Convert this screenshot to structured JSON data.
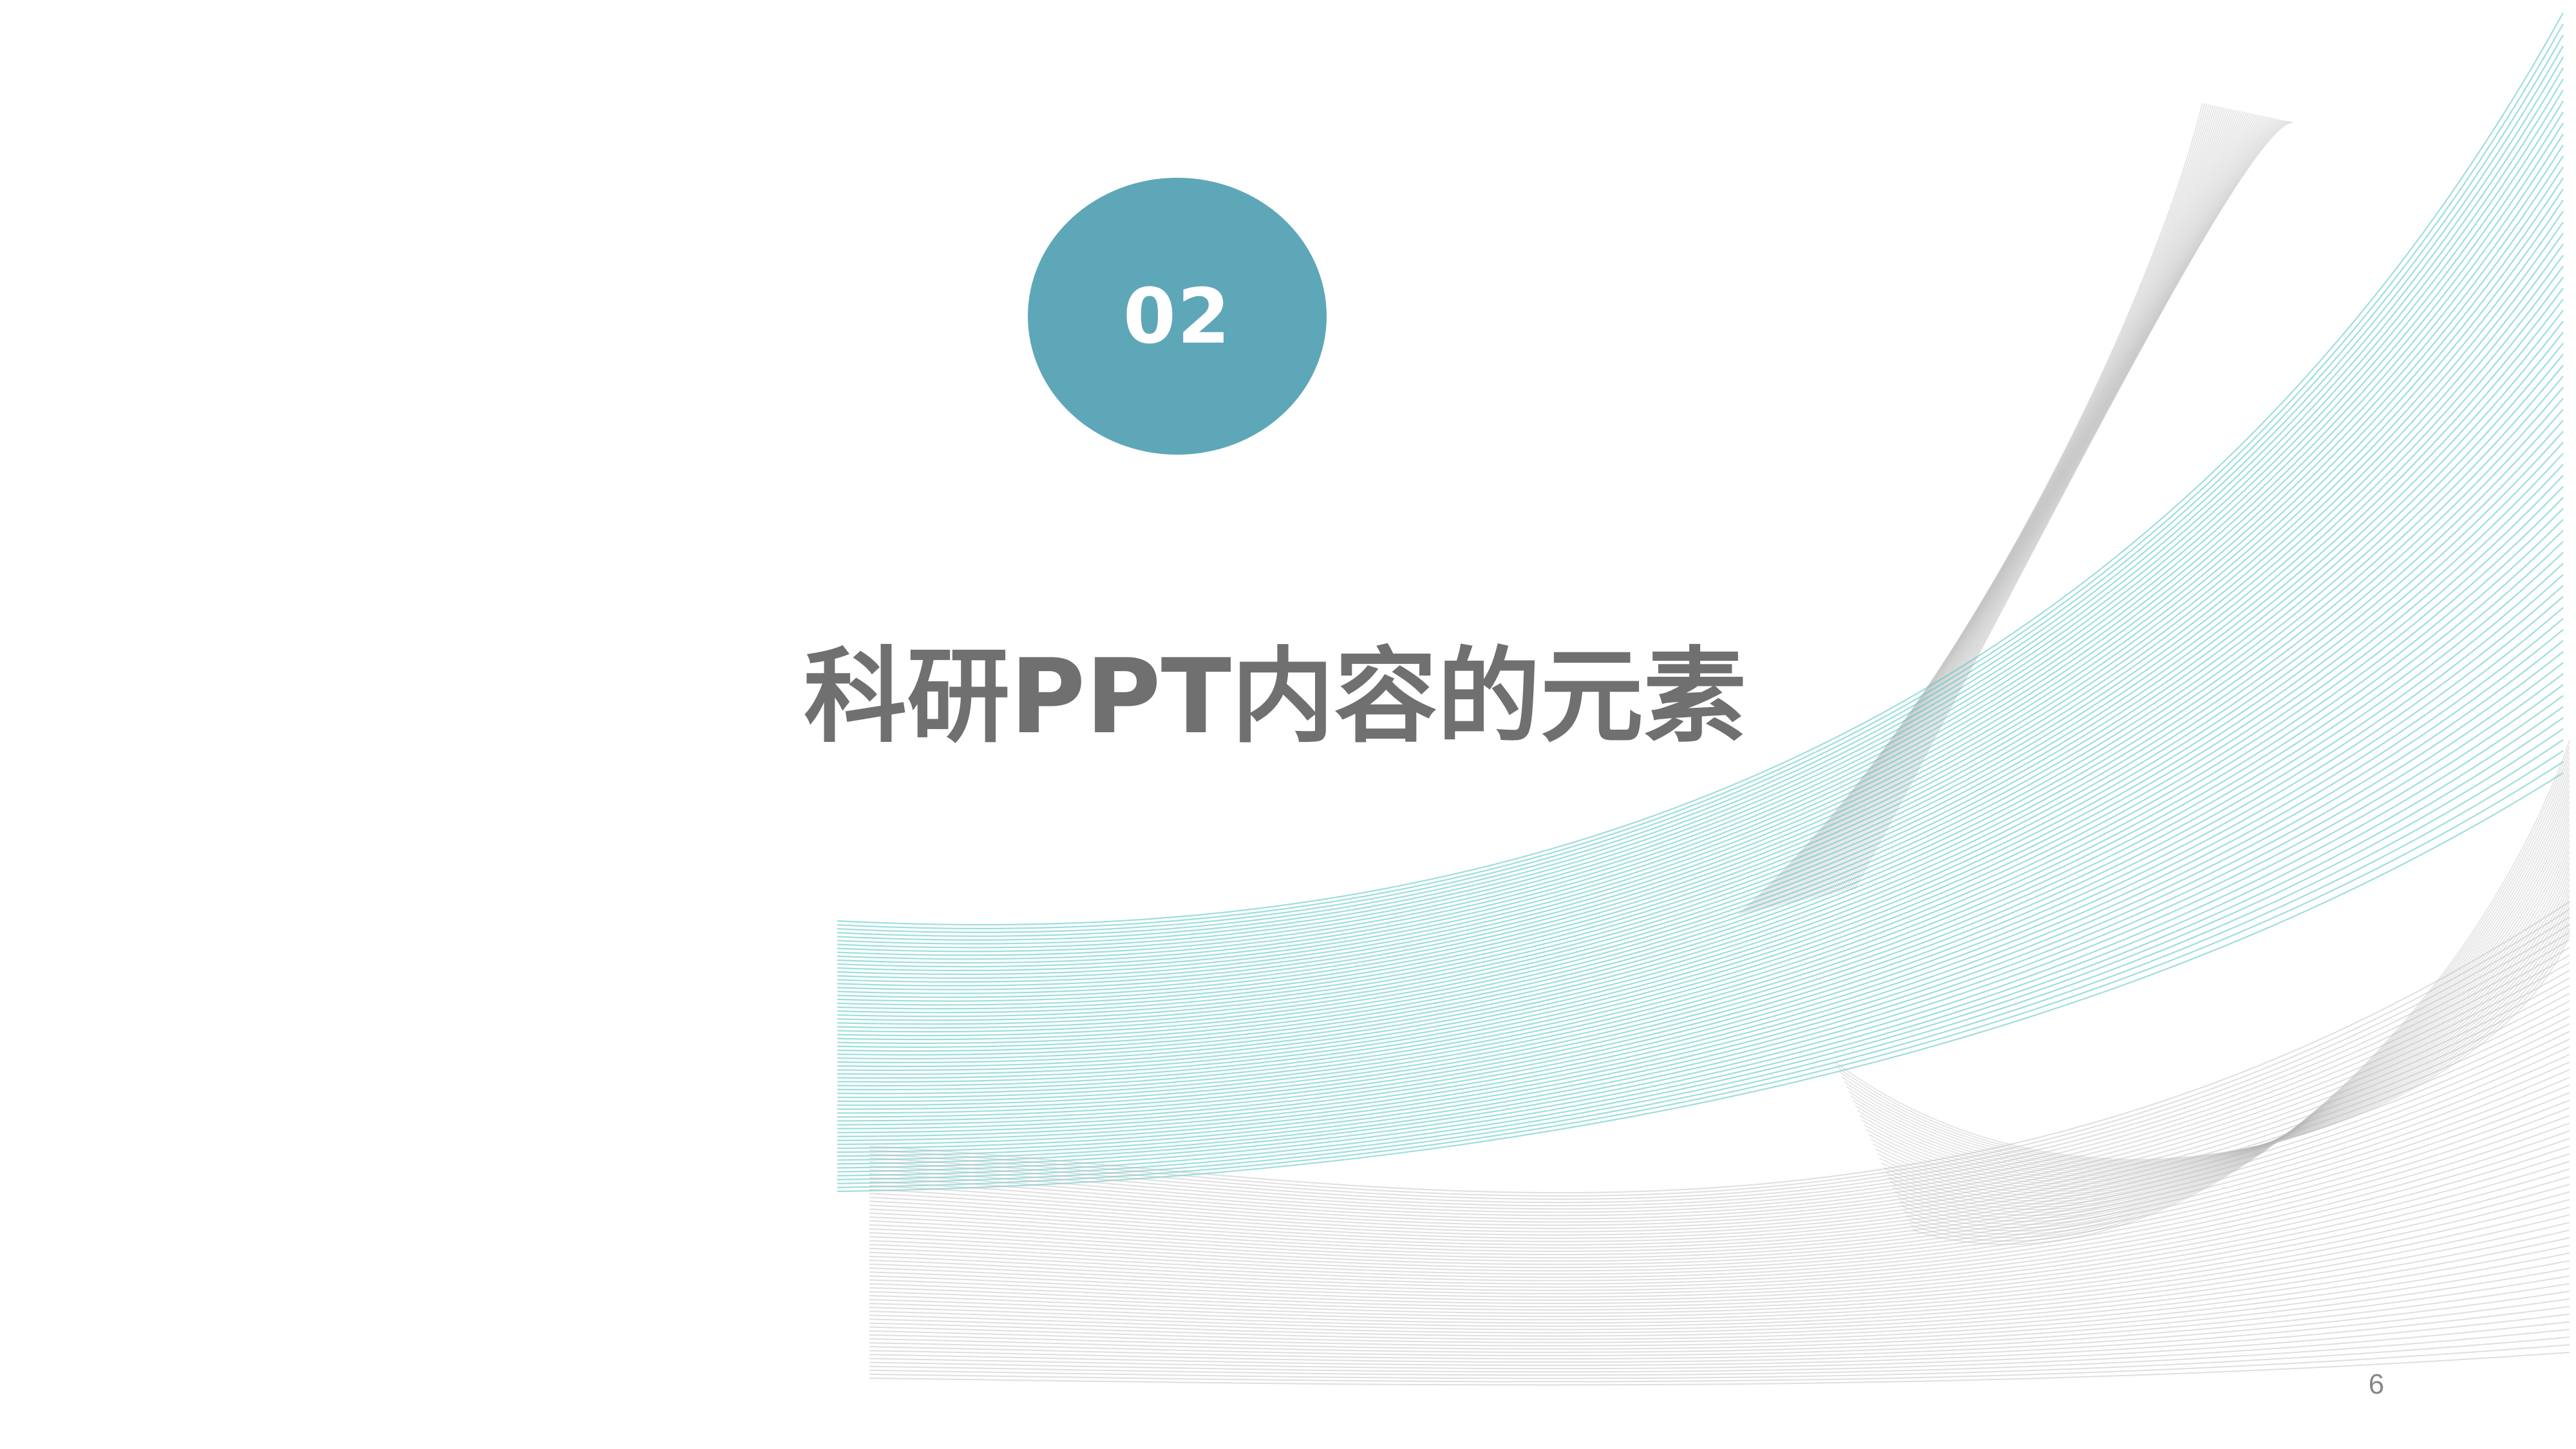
{
  "slide": {
    "section_number": "02",
    "title": "科研PPT内容的元素",
    "page_number": "6"
  },
  "colors": {
    "badge": "#5ea7b8",
    "title_text": "#707070",
    "wave_teal": "#4fc3c3",
    "wave_gray": "#b8b8b8"
  }
}
